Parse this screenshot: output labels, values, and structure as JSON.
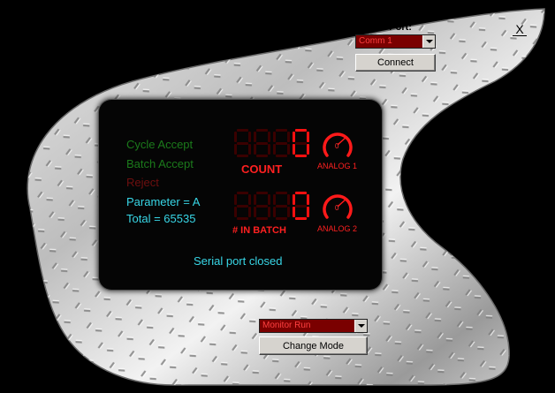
{
  "comm": {
    "label": "Comm Port:",
    "selected": "Comm 1",
    "connect_label": "Connect"
  },
  "close_label": "X",
  "indicators": [
    {
      "label": "Cycle Accept",
      "color": "#1b7a1b"
    },
    {
      "label": "Batch Accept",
      "color": "#1b7a1b"
    },
    {
      "label": "Reject",
      "color": "#6e0f0f"
    }
  ],
  "parameter": "Parameter = A",
  "total": "Total = 65535",
  "count": {
    "digits": "0",
    "label": "COUNT"
  },
  "in_batch": {
    "digits": "0",
    "label": "# IN BATCH"
  },
  "analog1": {
    "label": "ANALOG 1",
    "value": "0"
  },
  "analog2": {
    "label": "ANALOG 2",
    "value": "0"
  },
  "serial_status": "Serial port closed",
  "mode": {
    "selected": "Monitor Run",
    "change_label": "Change Mode"
  },
  "colors": {
    "led_on": "#ff1010",
    "led_off": "#3a0000",
    "cyan_text": "#38d6e6"
  }
}
